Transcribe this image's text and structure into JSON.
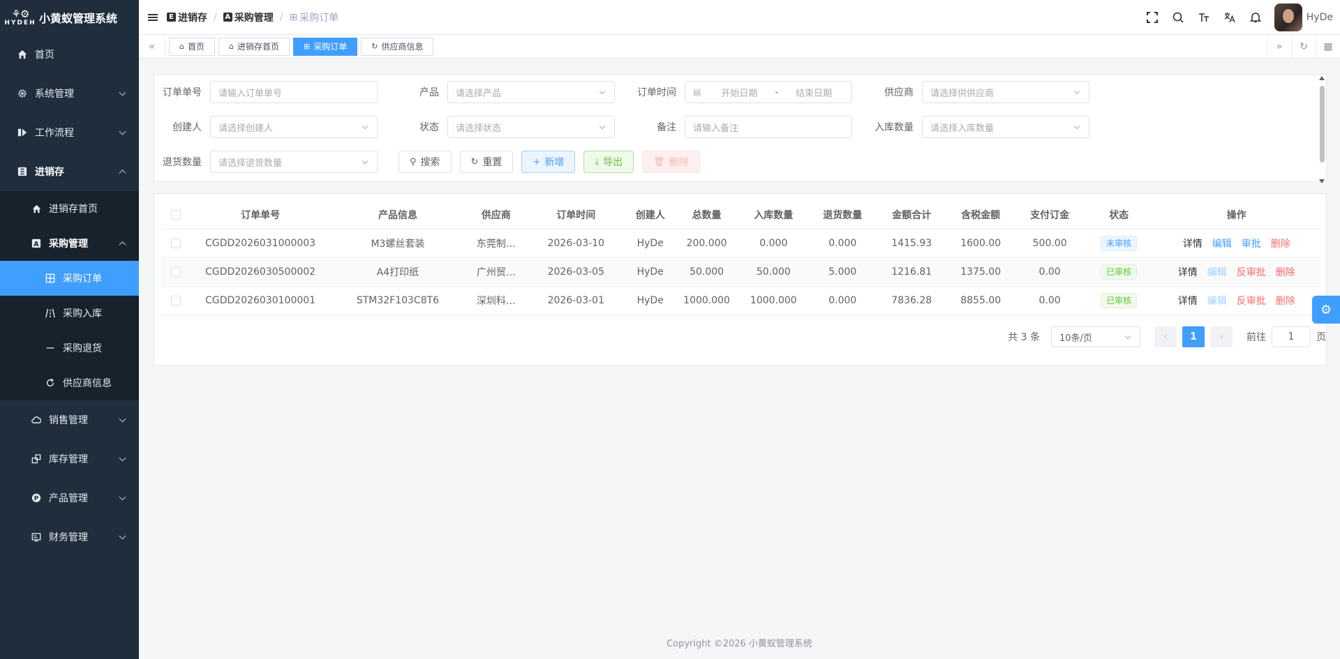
{
  "app": {
    "title": "小黄蚁管理系统",
    "logo_word": "HYDEH"
  },
  "sidebar": {
    "items": [
      {
        "label": "首页"
      },
      {
        "label": "系统管理"
      },
      {
        "label": "工作流程"
      },
      {
        "label": "进销存"
      },
      {
        "label": "销售管理"
      },
      {
        "label": "库存管理"
      },
      {
        "label": "产品管理"
      },
      {
        "label": "财务管理"
      }
    ],
    "sub": [
      {
        "label": "进销存首页"
      },
      {
        "label": "采购管理"
      }
    ],
    "subsub": [
      {
        "label": "采购订单"
      },
      {
        "label": "采购入库"
      },
      {
        "label": "采购退货"
      },
      {
        "label": "供应商信息"
      }
    ]
  },
  "header": {
    "breadcrumb": [
      "进销存",
      "采购管理",
      "采购订单"
    ],
    "crumb_sep": "/",
    "username": "HyDe"
  },
  "tags": [
    "首页",
    "进销存首页",
    "采购订单",
    "供应商信息"
  ],
  "search": {
    "order_no": {
      "label": "订单单号",
      "placeholder": "请输入订单单号"
    },
    "product": {
      "label": "产品",
      "placeholder": "请选择产品"
    },
    "order_time": {
      "label": "订单时间",
      "start": "开始日期",
      "sep": "-",
      "end": "结束日期"
    },
    "supplier": {
      "label": "供应商",
      "placeholder": "请选择供供应商"
    },
    "creator": {
      "label": "创建人",
      "placeholder": "请选择创建人"
    },
    "status": {
      "label": "状态",
      "placeholder": "请选择状态"
    },
    "remark": {
      "label": "备注",
      "placeholder": "请输入备注"
    },
    "in_qty": {
      "label": "入库数量",
      "placeholder": "请选择入库数量"
    },
    "return_qty": {
      "label": "退货数量",
      "placeholder": "请选择退货数量"
    },
    "buttons": {
      "search": "搜索",
      "reset": "重置",
      "add": "新增",
      "export": "导出",
      "delete": "删除"
    }
  },
  "table": {
    "headers": [
      "订单单号",
      "产品信息",
      "供应商",
      "订单时间",
      "创建人",
      "总数量",
      "入库数量",
      "退货数量",
      "金额合计",
      "含税金额",
      "支付订金",
      "状态",
      "操作"
    ],
    "rows": [
      {
        "no": "CGDD2026031000003",
        "product": "M3螺丝套装",
        "supplier": "东莞制…",
        "date": "2026-03-10",
        "creator": "HyDe",
        "total": "200.000",
        "in": "0.000",
        "ret": "0.000",
        "amount": "1415.93",
        "tax": "1600.00",
        "deposit": "500.00",
        "status": "未审核",
        "ops": [
          "详情",
          "编辑",
          "审批",
          "删除"
        ]
      },
      {
        "no": "CGDD2026030500002",
        "product": "A4打印纸",
        "supplier": "广州贸…",
        "date": "2026-03-05",
        "creator": "HyDe",
        "total": "50.000",
        "in": "50.000",
        "ret": "5.000",
        "amount": "1216.81",
        "tax": "1375.00",
        "deposit": "0.00",
        "status": "已审核",
        "ops": [
          "详情",
          "编辑",
          "反审批",
          "删除"
        ]
      },
      {
        "no": "CGDD2026030100001",
        "product": "STM32F103C8T6",
        "supplier": "深圳科…",
        "date": "2026-03-01",
        "creator": "HyDe",
        "total": "1000.000",
        "in": "1000.000",
        "ret": "0.000",
        "amount": "7836.28",
        "tax": "8855.00",
        "deposit": "0.00",
        "status": "已审核",
        "ops": [
          "详情",
          "编辑",
          "反审批",
          "删除"
        ]
      }
    ]
  },
  "pager": {
    "total": "共 3 条",
    "size": "10条/页",
    "current": "1",
    "goto": "前往",
    "goto_value": "1",
    "page_unit": "页"
  },
  "footer": "Copyright ©2026 小黄蚁管理系统",
  "colors": {
    "primary": "#409eff",
    "sidebar": "#1f2d3d",
    "success": "#67c23a",
    "danger": "#f56c6c"
  }
}
